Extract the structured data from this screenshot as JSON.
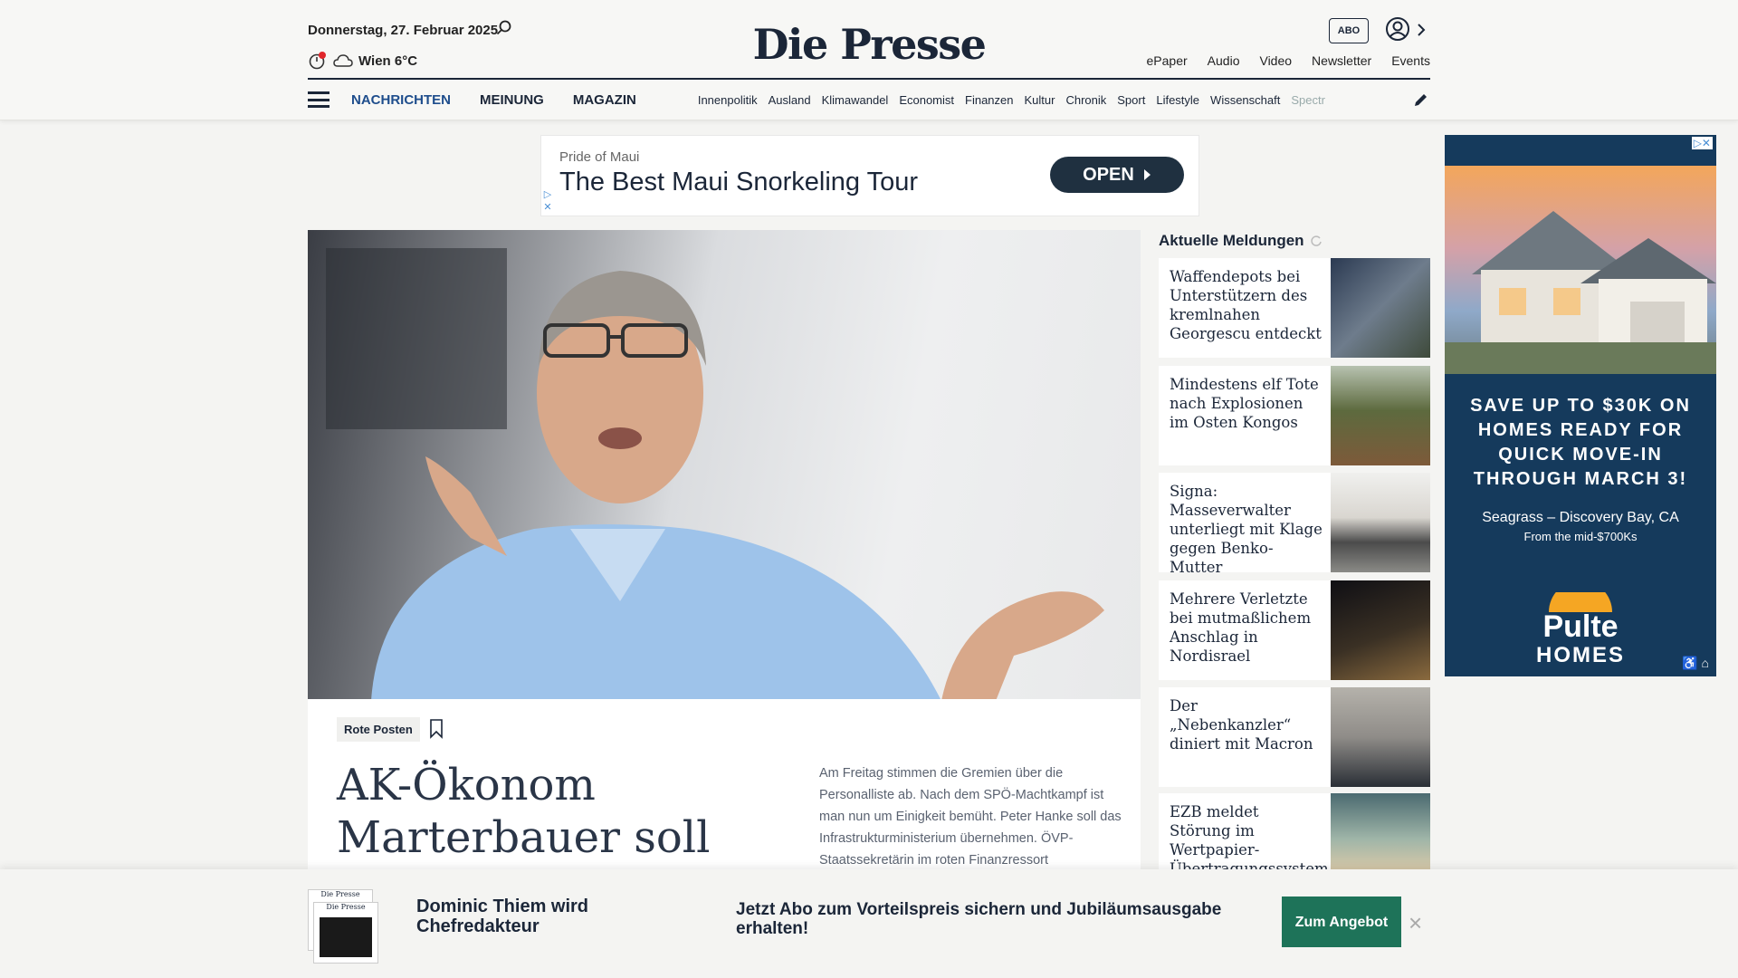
{
  "header": {
    "date": "Donnerstag, 27. Februar 2025",
    "weather": "Wien 6°C",
    "logo": "Die Presse",
    "abo_label": "ABO",
    "top_links": [
      "ePaper",
      "Audio",
      "Video",
      "Newsletter",
      "Events"
    ]
  },
  "nav": {
    "main": [
      "NACHRICHTEN",
      "MEINUNG",
      "MAGAZIN"
    ],
    "sub": [
      "Innenpolitik",
      "Ausland",
      "Klimawandel",
      "Economist",
      "Finanzen",
      "Kultur",
      "Chronik",
      "Sport",
      "Lifestyle",
      "Wissenschaft",
      "Spectr"
    ]
  },
  "ad_banner": {
    "sponsor": "Pride of Maui",
    "headline": "The Best Maui Snorkeling Tour",
    "button": "OPEN"
  },
  "hero": {
    "tag": "Rote Posten",
    "headline": "AK-Ökonom Marterbauer soll",
    "lead": "Am Freitag stimmen die Gremien über die Personalliste ab. Nach dem SPÖ-Machtkampf ist man nun um Einigkeit bemüht. Peter Hanke soll das Infrastrukturministerium übernehmen. ÖVP-Staatssekretärin im roten Finanzressort"
  },
  "sidebar": {
    "heading": "Aktuelle Meldungen",
    "items": [
      {
        "title": "Waffendepots bei Unterstützern des kremlnahen Georgescu entdeckt"
      },
      {
        "title": "Mindestens elf Tote nach Explosionen im Osten Kongos"
      },
      {
        "title": "Signa: Masseverwalter unterliegt mit Klage gegen Benko-Mutter"
      },
      {
        "title": "Mehrere Verletzte bei mutmaßlichem Anschlag in Nordisrael"
      },
      {
        "title": "Der „Nebenkanzler“ diniert mit Macron"
      },
      {
        "title": "EZB meldet Störung im Wertpapier-Übertragungssystem"
      }
    ]
  },
  "side_ad": {
    "promo": "SAVE UP TO $30K ON HOMES READY FOR QUICK MOVE-IN THROUGH MARCH 3!",
    "location": "Seagrass – Discovery Bay, CA",
    "price": "From the mid-$700Ks",
    "brand_line1": "Pulte",
    "brand_line2": "HOMES"
  },
  "bottom_bar": {
    "left_text": "Dominic Thiem wird Chefredakteur",
    "mid_text": "Jetzt Abo zum Vorteilspreis sichern und Jubiläumsausgabe erhalten!",
    "button": "Zum Angebot",
    "close": "×"
  },
  "colors": {
    "brand_navy": "#1b2638",
    "nav_active": "#1e4d8c",
    "cta_green": "#1e7359",
    "ad_navy": "#153a5c"
  }
}
